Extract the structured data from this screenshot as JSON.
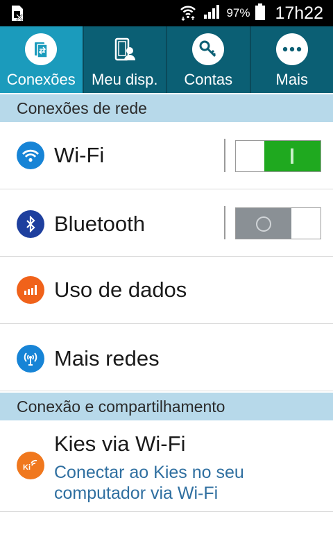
{
  "status_bar": {
    "battery_percent": "97%",
    "time": "17h22",
    "icons": [
      "sim-card-x-icon",
      "wifi-icon",
      "signal-icon",
      "battery-icon"
    ]
  },
  "tabs": [
    {
      "label": "Conexões",
      "icon": "connections-icon",
      "active": true
    },
    {
      "label": "Meu disp.",
      "icon": "my-device-icon",
      "active": false
    },
    {
      "label": "Contas",
      "icon": "accounts-key-icon",
      "active": false
    },
    {
      "label": "Mais",
      "icon": "more-dots-icon",
      "active": false
    }
  ],
  "sections": {
    "network": "Conexões de rede",
    "sharing": "Conexão e compartilhamento"
  },
  "items": {
    "wifi": {
      "title": "Wi-Fi",
      "icon": "wifi-icon",
      "toggle": "on"
    },
    "bluetooth": {
      "title": "Bluetooth",
      "icon": "bluetooth-icon",
      "toggle": "off"
    },
    "data_usage": {
      "title": "Uso de dados",
      "icon": "data-usage-icon"
    },
    "more_networks": {
      "title": "Mais redes",
      "icon": "more-networks-icon"
    },
    "kies": {
      "title": "Kies via Wi-Fi",
      "subtitle": "Conectar ao Kies no seu computador via Wi-Fi",
      "icon": "kies-icon"
    }
  },
  "colors": {
    "tab_bg": "#0b5f74",
    "tab_active": "#1b9bbc",
    "section_bg": "#b7d9ea",
    "switch_on": "#1fa91f",
    "switch_off": "#8a9095",
    "subtitle": "#2f6fa0"
  }
}
